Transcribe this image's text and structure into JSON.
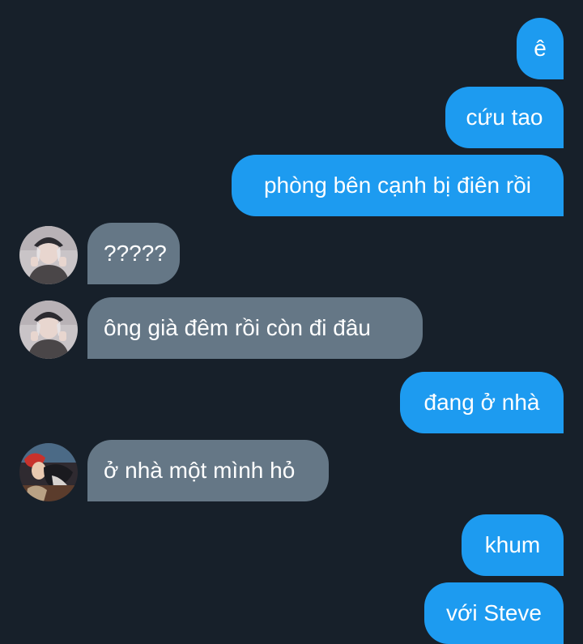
{
  "messages": [
    {
      "side": "out",
      "text": "ê"
    },
    {
      "side": "out",
      "text": "cứu tao"
    },
    {
      "side": "out",
      "text": "phòng bên cạnh bị điên rồi"
    },
    {
      "side": "in",
      "text": "?????",
      "avatar": "contact-a-avatar"
    },
    {
      "side": "in",
      "text": "ông già đêm rồi còn đi đâu",
      "avatar": "contact-a-avatar"
    },
    {
      "side": "out",
      "text": "đang ở nhà"
    },
    {
      "side": "in",
      "text": "ở nhà một mình hỏ",
      "avatar": "contact-b-avatar"
    },
    {
      "side": "out",
      "text": "khum"
    },
    {
      "side": "out",
      "text": "với Steve"
    }
  ],
  "colors": {
    "background": "#17202a",
    "outgoing_bubble": "#1d9bf0",
    "incoming_bubble": "#657786",
    "text": "#ffffff"
  }
}
